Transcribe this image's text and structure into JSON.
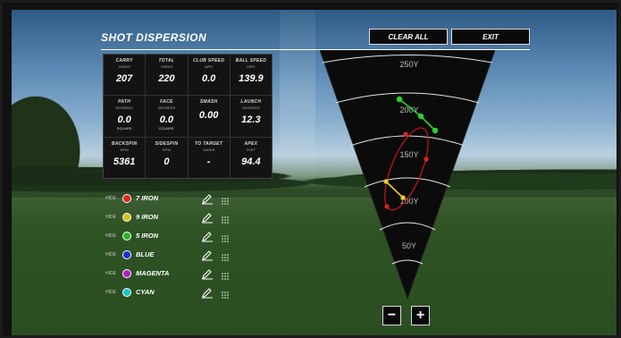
{
  "header": {
    "title": "SHOT DISPERSION",
    "clear_all": "CLEAR ALL",
    "exit": "EXIT"
  },
  "stats": [
    {
      "label": "CARRY",
      "unit": "YARDS",
      "value": "207",
      "sub": ""
    },
    {
      "label": "TOTAL",
      "unit": "YARDS",
      "value": "220",
      "sub": ""
    },
    {
      "label": "CLUB SPEED",
      "unit": "MPH",
      "value": "0.0",
      "sub": ""
    },
    {
      "label": "BALL SPEED",
      "unit": "MPH",
      "value": "139.9",
      "sub": ""
    },
    {
      "label": "PATH",
      "unit": "DEGREES",
      "value": "0.0",
      "sub": "SQUARE"
    },
    {
      "label": "FACE",
      "unit": "DEGREES",
      "value": "0.0",
      "sub": "SQUARE"
    },
    {
      "label": "SMASH",
      "unit": "",
      "value": "0.00",
      "sub": ""
    },
    {
      "label": "LAUNCH",
      "unit": "DEGREES",
      "value": "12.3",
      "sub": ""
    },
    {
      "label": "BACKSPIN",
      "unit": "RPM",
      "value": "5361",
      "sub": ""
    },
    {
      "label": "SIDESPIN",
      "unit": "RPM",
      "value": "0",
      "sub": ""
    },
    {
      "label": "TO TARGET",
      "unit": "YARDS",
      "value": "-",
      "sub": ""
    },
    {
      "label": "APEX",
      "unit": "FEET",
      "value": "94.4",
      "sub": ""
    }
  ],
  "clubs": [
    {
      "hide": "HIDE",
      "name": "7 IRON",
      "color": "#e0231d"
    },
    {
      "hide": "HIDE",
      "name": "9 IRON",
      "color": "#d9c21a"
    },
    {
      "hide": "HIDE",
      "name": "5 IRON",
      "color": "#2bb52b"
    },
    {
      "hide": "HIDE",
      "name": "BLUE",
      "color": "#1a2fd0"
    },
    {
      "hide": "HIDE",
      "name": "MAGENTA",
      "color": "#b21bc4"
    },
    {
      "hide": "HIDE",
      "name": "CYAN",
      "color": "#1fc3c3"
    }
  ],
  "dispersion": {
    "distance_labels": [
      "250Y",
      "200Y",
      "150Y",
      "100Y",
      "50Y"
    ],
    "shots": {
      "5_iron": [
        [
          444,
          108
        ],
        [
          468,
          127
        ],
        [
          484,
          143
        ]
      ],
      "9_iron": [
        [
          429,
          200
        ],
        [
          448,
          218
        ]
      ],
      "7_iron": [
        [
          451,
          147
        ],
        [
          474,
          175
        ],
        [
          430,
          228
        ]
      ]
    }
  },
  "zoom": {
    "out": "−",
    "in": "+"
  },
  "icons": {
    "edit": "pencil-icon",
    "scatter": "dots-grid-icon"
  }
}
